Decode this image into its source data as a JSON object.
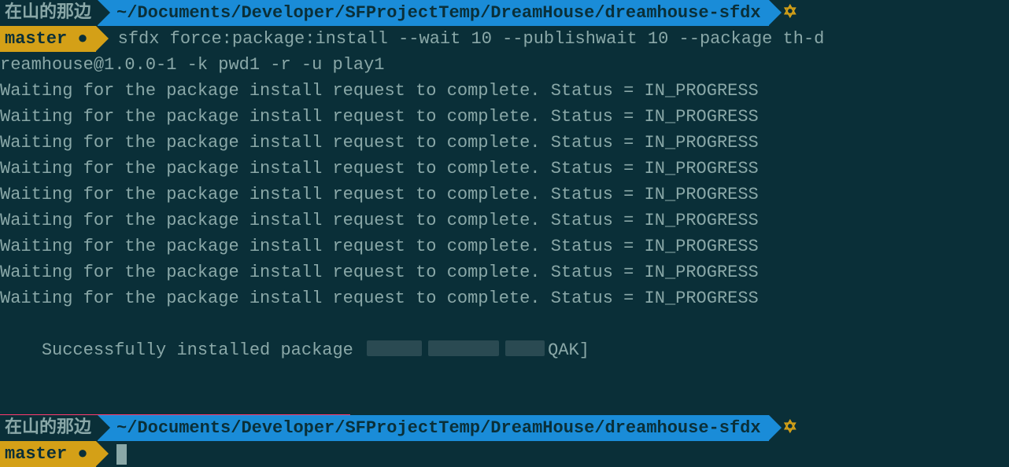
{
  "prompt1": {
    "host": "在山的那边",
    "path": "~/Documents/Developer/SFProjectTemp/DreamHouse/dreamhouse-sfdx",
    "branch": "master ●",
    "command_part1": "sfdx force:package:install --wait 10 --publishwait 10 --package th-d",
    "command_part2": "reamhouse@1.0.0-1 -k pwd1 -r -u play1"
  },
  "output": {
    "waiting_line": "Waiting for the package install request to complete. Status = IN_PROGRESS",
    "waiting_count": 9,
    "success_prefix": "Successfully installed package ",
    "success_suffix": "QAK]"
  },
  "prompt2": {
    "host": "在山的那边",
    "path": "~/Documents/Developer/SFProjectTemp/DreamHouse/dreamhouse-sfdx",
    "branch": "master ●"
  }
}
